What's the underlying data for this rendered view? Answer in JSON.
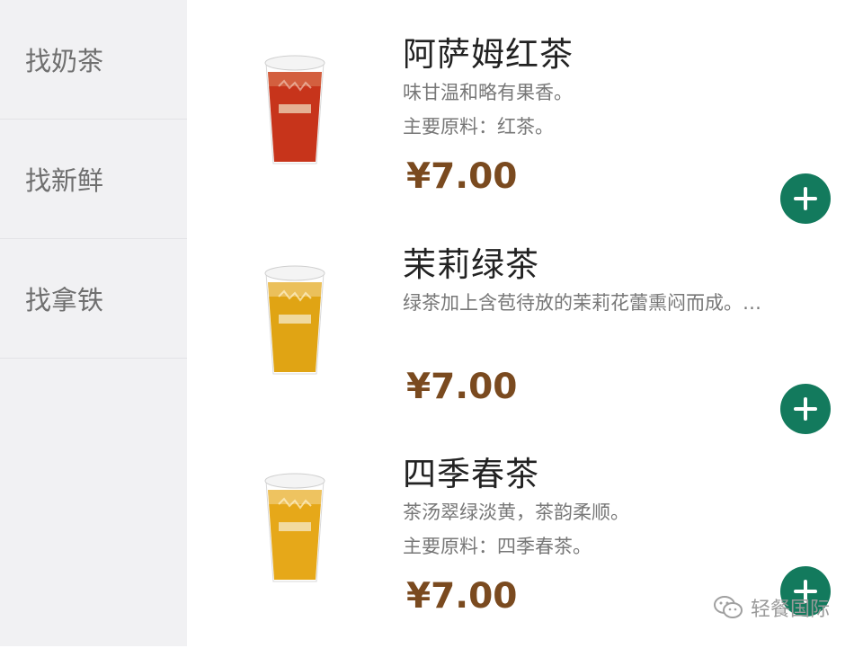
{
  "sidebar": {
    "categories": [
      {
        "label": "找奶茶"
      },
      {
        "label": "找新鲜"
      },
      {
        "label": "找拿铁"
      }
    ]
  },
  "products": [
    {
      "name": "阿萨姆红茶",
      "desc": "味甘温和略有果香。",
      "ingredients": "主要原料：红茶。",
      "price": "¥7.00",
      "drink_color": "#c7341b"
    },
    {
      "name": "茉莉绿茶",
      "desc": "绿茶加上含苞待放的茉莉花蕾熏闷而成。…",
      "price": "¥7.00",
      "drink_color": "#e0a414"
    },
    {
      "name": "四季春茶",
      "desc": "茶汤翠绿淡黄，茶韵柔顺。",
      "ingredients": "主要原料：四季春茶。",
      "price": "¥7.00",
      "drink_color": "#e6a819"
    }
  ],
  "watermark": {
    "text": "轻餐国际",
    "icon": "wechat-icon"
  },
  "colors": {
    "accent": "#137a5d",
    "price": "#7a4a1f"
  }
}
